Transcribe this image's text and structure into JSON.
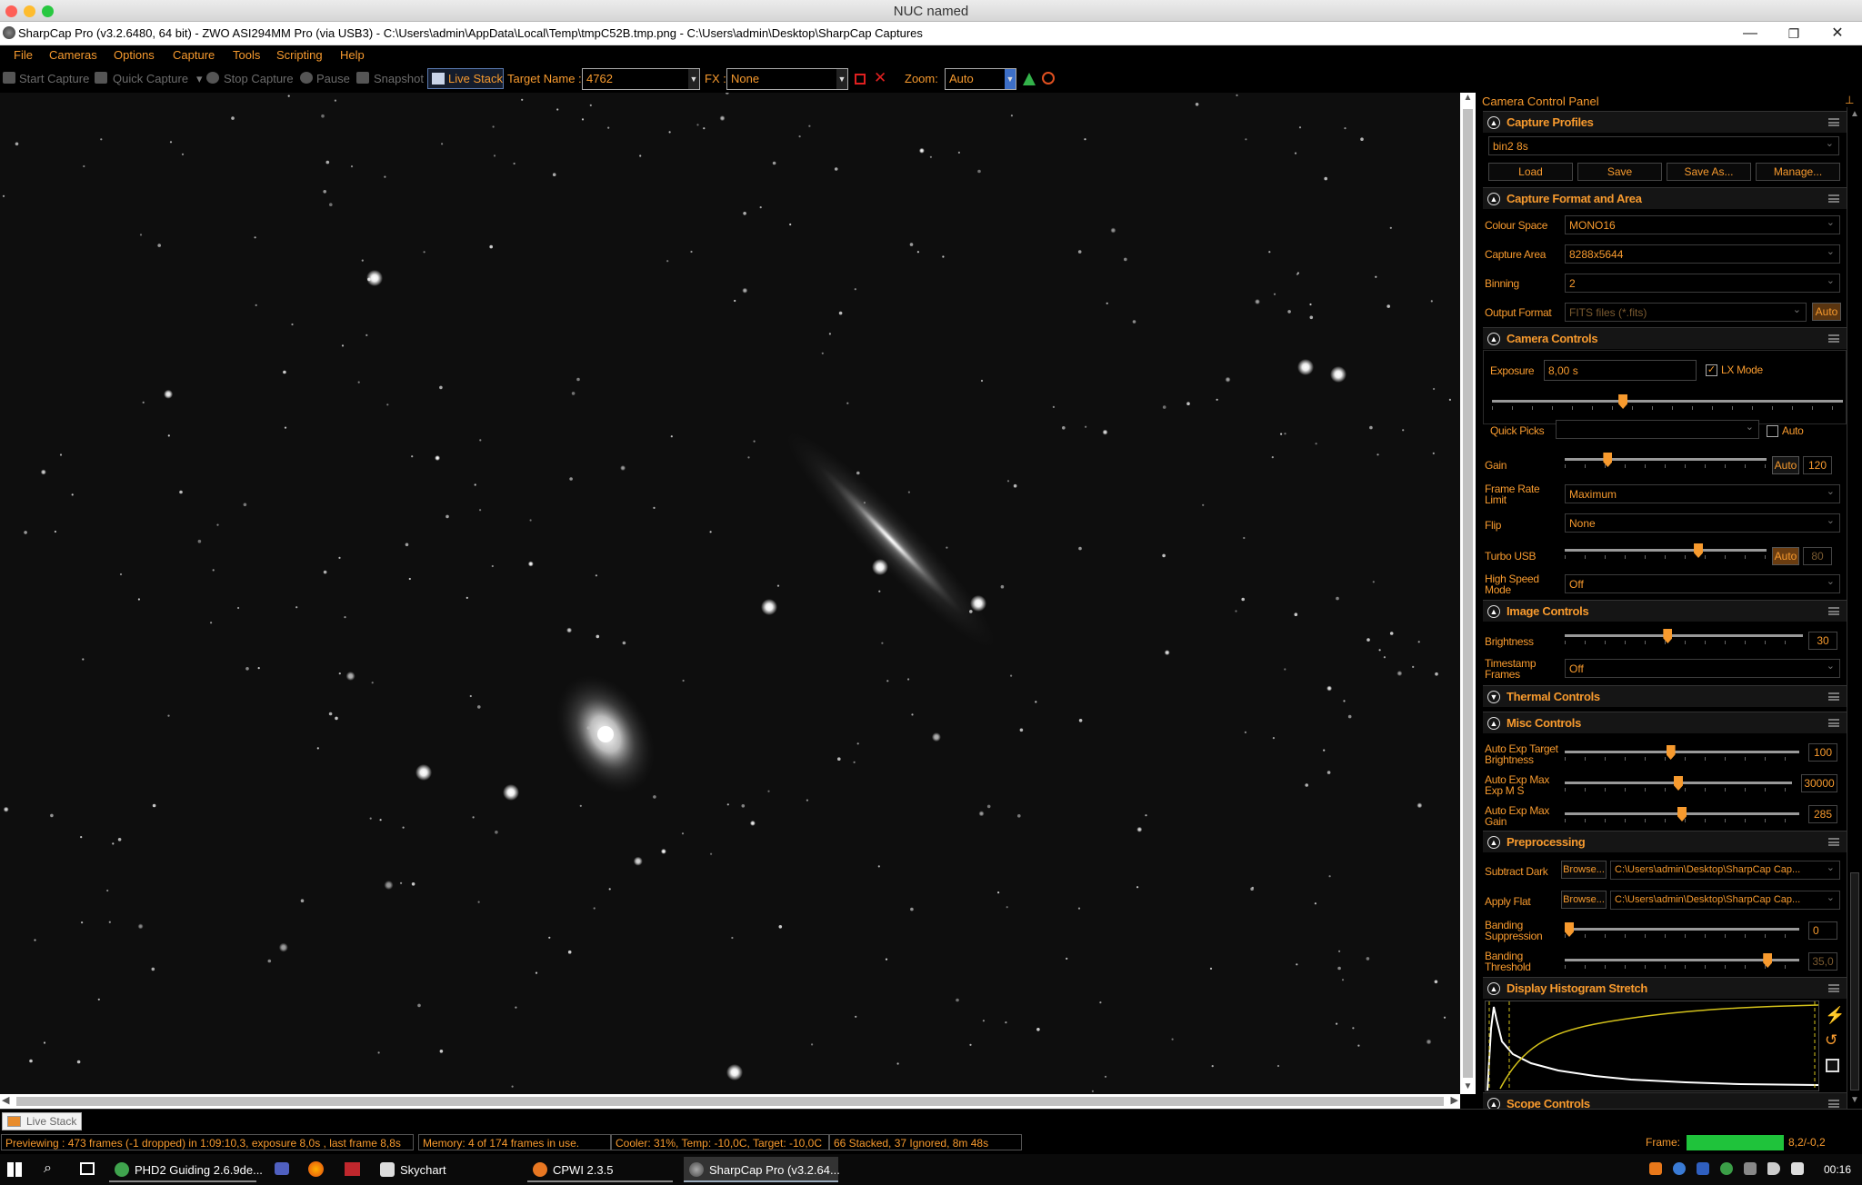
{
  "mac_title": "NUC named",
  "window": {
    "title": "SharpCap Pro (v3.2.6480, 64 bit) - ZWO ASI294MM Pro (via USB3) - C:\\Users\\admin\\AppData\\Local\\Temp\\tmpC52B.tmp.png - C:\\Users\\admin\\Desktop\\SharpCap Captures",
    "minimize": "—",
    "restore": "❐",
    "close": "✕"
  },
  "menu": [
    "File",
    "Cameras",
    "Options",
    "Capture",
    "Tools",
    "Scripting",
    "Help"
  ],
  "toolbar": {
    "start_capture": "Start Capture",
    "quick_capture": "Quick Capture",
    "stop_capture": "Stop Capture",
    "pause": "Pause",
    "snapshot": "Snapshot",
    "live_stack": "Live Stack",
    "target_label": "Target Name :",
    "target_value": "4762",
    "fx_label": "FX :",
    "fx_value": "None",
    "zoom_label": "Zoom:",
    "zoom_value": "Auto"
  },
  "panel": {
    "title": "Camera Control Panel",
    "capture_profiles": {
      "title": "Capture Profiles",
      "profile": "bin2 8s",
      "load": "Load",
      "save": "Save",
      "save_as": "Save As...",
      "manage": "Manage..."
    },
    "capture_format": {
      "title": "Capture Format and Area",
      "colour_space_label": "Colour Space",
      "colour_space": "MONO16",
      "capture_area_label": "Capture Area",
      "capture_area": "8288x5644",
      "binning_label": "Binning",
      "binning": "2",
      "output_format_label": "Output Format",
      "output_format": "FITS files (*.fits)",
      "auto": "Auto"
    },
    "camera_controls": {
      "title": "Camera Controls",
      "exposure_label": "Exposure",
      "exposure": "8,00 s",
      "exposure_level": 0.37,
      "lx_mode": "LX Mode",
      "lx_checked": true,
      "quick_picks_label": "Quick Picks",
      "quick_picks_auto": "Auto",
      "gain_label": "Gain",
      "gain_auto": "Auto",
      "gain": "120",
      "gain_level": 0.2,
      "frame_rate_label": "Frame Rate Limit",
      "frame_rate": "Maximum",
      "flip_label": "Flip",
      "flip": "None",
      "turbo_label": "Turbo USB",
      "turbo_auto": "Auto",
      "turbo": "80",
      "turbo_level": 0.67,
      "high_speed_label": "High Speed Mode",
      "high_speed": "Off"
    },
    "image_controls": {
      "title": "Image Controls",
      "brightness_label": "Brightness",
      "brightness": "30",
      "brightness_level": 0.43,
      "timestamp_label": "Timestamp Frames",
      "timestamp": "Off"
    },
    "thermal": {
      "title": "Thermal Controls"
    },
    "misc": {
      "title": "Misc Controls",
      "aet_label": "Auto Exp Target Brightness",
      "aet": "100",
      "aet_level": 0.45,
      "aem_label": "Auto Exp Max Exp M S",
      "aem": "30000",
      "aem_level": 0.5,
      "aeg_label": "Auto Exp Max Gain",
      "aeg": "285",
      "aeg_level": 0.5
    },
    "preprocessing": {
      "title": "Preprocessing",
      "dark_label": "Subtract Dark",
      "browse": "Browse...",
      "dark_path": "C:\\Users\\admin\\Desktop\\SharpCap Cap...",
      "flat_label": "Apply Flat",
      "flat_path": "C:\\Users\\admin\\Desktop\\SharpCap Cap...",
      "banding_sup_label": "Banding Suppression",
      "banding_sup": "0",
      "banding_sup_level": 0.0,
      "banding_thr_label": "Banding Threshold",
      "banding_thr": "35,0",
      "banding_thr_level": 0.88
    },
    "histogram": {
      "title": "Display Histogram Stretch"
    },
    "scope": {
      "title": "Scope Controls"
    }
  },
  "tab": {
    "live_stack": "Live Stack"
  },
  "status": {
    "previewing": "Previewing : 473 frames (-1 dropped) in 1:09:10,3, exposure 8,0s , last frame 8,8s",
    "memory": "Memory: 4 of 174 frames in use.",
    "cooler": "Cooler: 31%, Temp: -10,0C, Target: -10,0C",
    "stacked": "66 Stacked, 37 Ignored, 8m 48s",
    "frame_label": "Frame:",
    "frame_value": "8,2/-0,2"
  },
  "taskbar": {
    "apps": [
      "PHD2 Guiding 2.6.9de...",
      "Skychart",
      "CPWI 2.3.5",
      "SharpCap Pro (v3.2.64..."
    ],
    "time": "00:16"
  },
  "colors": {
    "accent": "#f79a2e",
    "background": "#000000",
    "frame_bar": "#1fc33b"
  }
}
